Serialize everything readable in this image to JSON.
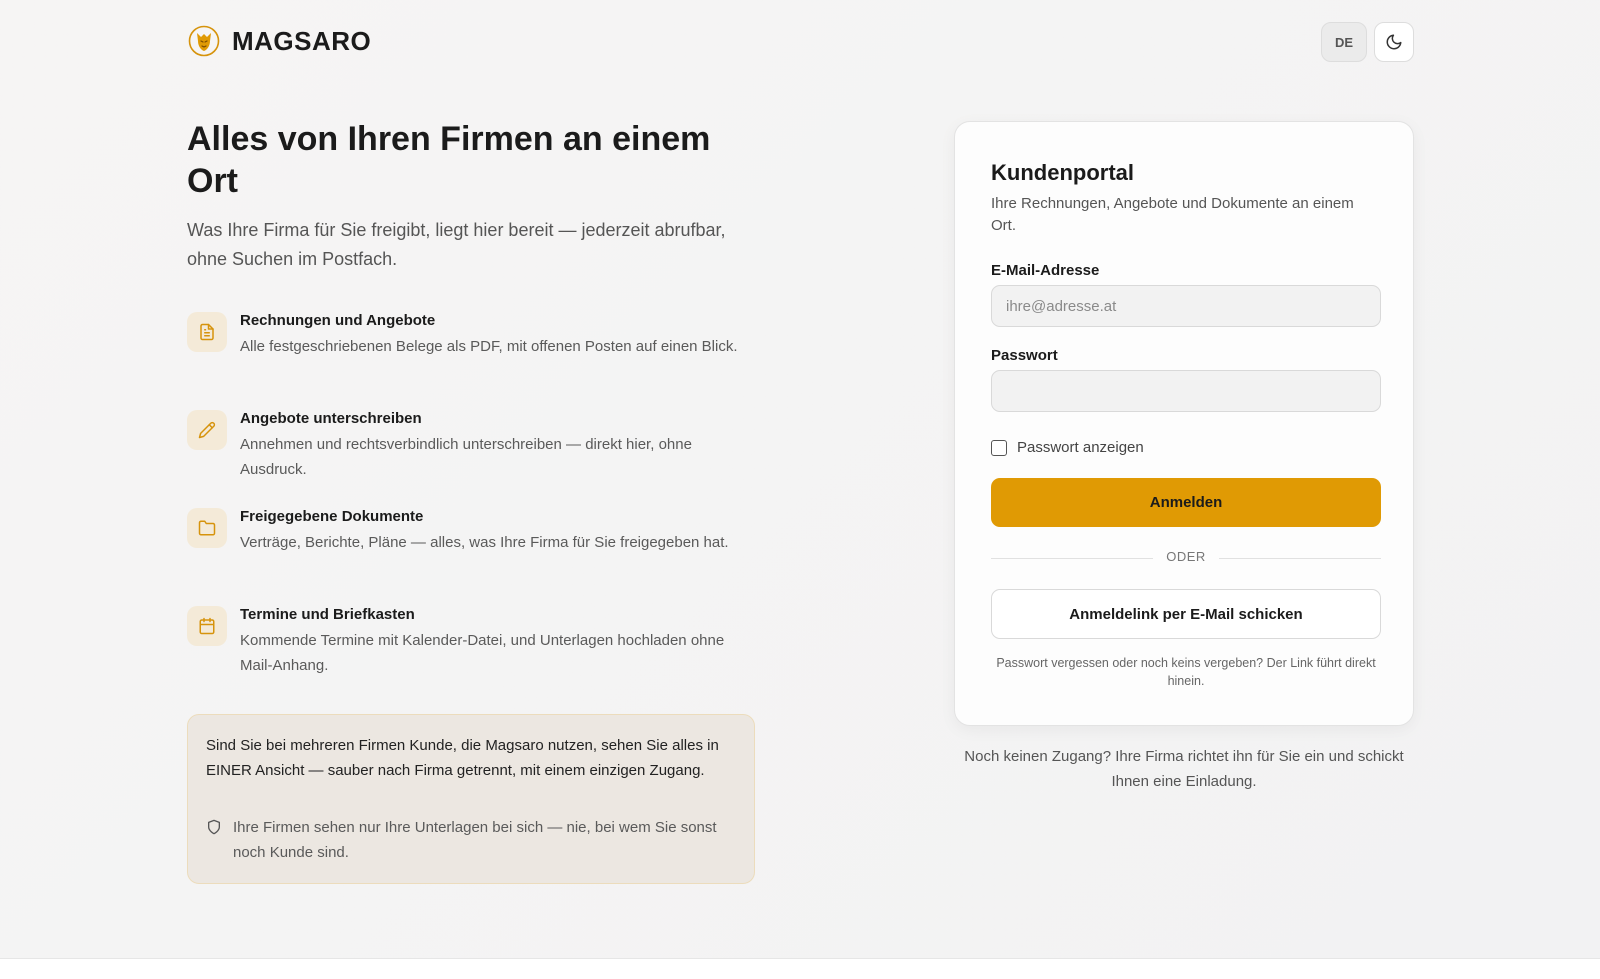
{
  "header": {
    "brand_name": "MAGSARO",
    "language_label": "DE",
    "theme_icon": "moon-icon"
  },
  "hero": {
    "title": "Alles von Ihren Firmen an einem Ort",
    "subtitle": "Was Ihre Firma für Sie freigibt, liegt hier bereit — jederzeit abrufbar, ohne Suchen im Postfach."
  },
  "features": [
    {
      "icon": "document-icon",
      "title": "Rechnungen und Angebote",
      "description": "Alle festgeschriebenen Belege als PDF, mit offenen Posten auf einen Blick."
    },
    {
      "icon": "pencil-icon",
      "title": "Angebote unterschreiben",
      "description": "Annehmen und rechtsverbindlich unterschreiben — direkt hier, ohne Ausdruck."
    },
    {
      "icon": "folder-icon",
      "title": "Freigegebene Dokumente",
      "description": "Verträge, Berichte, Pläne — alles, was Ihre Firma für Sie freigegeben hat."
    },
    {
      "icon": "calendar-icon",
      "title": "Termine und Briefkasten",
      "description": "Kommende Termine mit Kalender-Datei, und Unterlagen hochladen ohne Mail-Anhang."
    }
  ],
  "info_box": {
    "main": "Sind Sie bei mehreren Firmen Kunde, die Magsaro nutzen, sehen Sie alles in EINER Ansicht — sauber nach Firma getrennt, mit einem einzigen Zugang.",
    "note_icon": "shield-icon",
    "note": "Ihre Firmen sehen nur Ihre Unterlagen bei sich — nie, bei wem Sie sonst noch Kunde sind."
  },
  "login": {
    "title": "Kundenportal",
    "subtitle": "Ihre Rechnungen, Angebote und Dokumente an einem Ort.",
    "email_label": "E-Mail-Adresse",
    "email_placeholder": "ihre@adresse.at",
    "email_value": "",
    "password_label": "Passwort",
    "password_value": "",
    "show_password_label": "Passwort anzeigen",
    "submit_label": "Anmelden",
    "divider_label": "ODER",
    "magic_link_label": "Anmeldelink per E-Mail schicken",
    "hint": "Passwort vergessen oder noch keins vergeben? Der Link führt direkt hinein.",
    "no_access_text": "Noch keinen Zugang? Ihre Firma richtet ihn für Sie ein und schickt Ihnen eine Einladung."
  },
  "colors": {
    "accent": "#e09a04",
    "icon_bg": "#f4ead8",
    "icon_stroke": "#d6930c"
  }
}
